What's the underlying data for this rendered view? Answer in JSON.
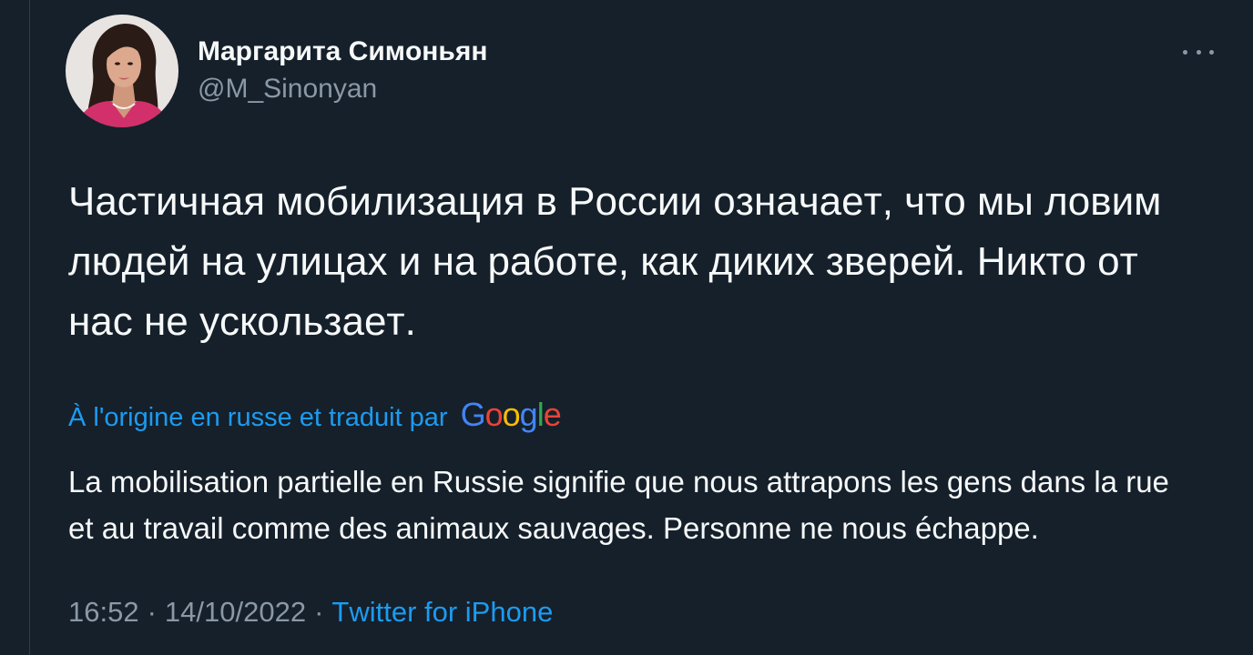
{
  "theme": {
    "background": "#15202b",
    "text": "#f7f9f9",
    "muted": "#8b98a5",
    "accent": "#1d9bf0",
    "border": "#2f3b47"
  },
  "author": {
    "display_name": "Маргарита Симоньян",
    "handle": "@M_Sinonyan"
  },
  "header": {
    "more_icon": "more-horizontal-icon"
  },
  "tweet": {
    "text": "Частичная мобилизация в России означает, что мы ловим людей на улицах и на работе, как диких зверей. Никто от нас не ускользает."
  },
  "translation": {
    "label": "À l'origine en russe et traduit par",
    "provider": "Google",
    "provider_colors": [
      "#4285f4",
      "#ea4335",
      "#fbbc05",
      "#4285f4",
      "#34a853",
      "#ea4335"
    ],
    "text": "La mobilisation partielle en Russie signifie que nous attrapons les gens dans la rue et au travail comme des animaux sauvages. Personne ne nous échappe."
  },
  "meta": {
    "time": "16:52",
    "separator": "·",
    "date": "14/10/2022",
    "source": "Twitter for iPhone"
  }
}
